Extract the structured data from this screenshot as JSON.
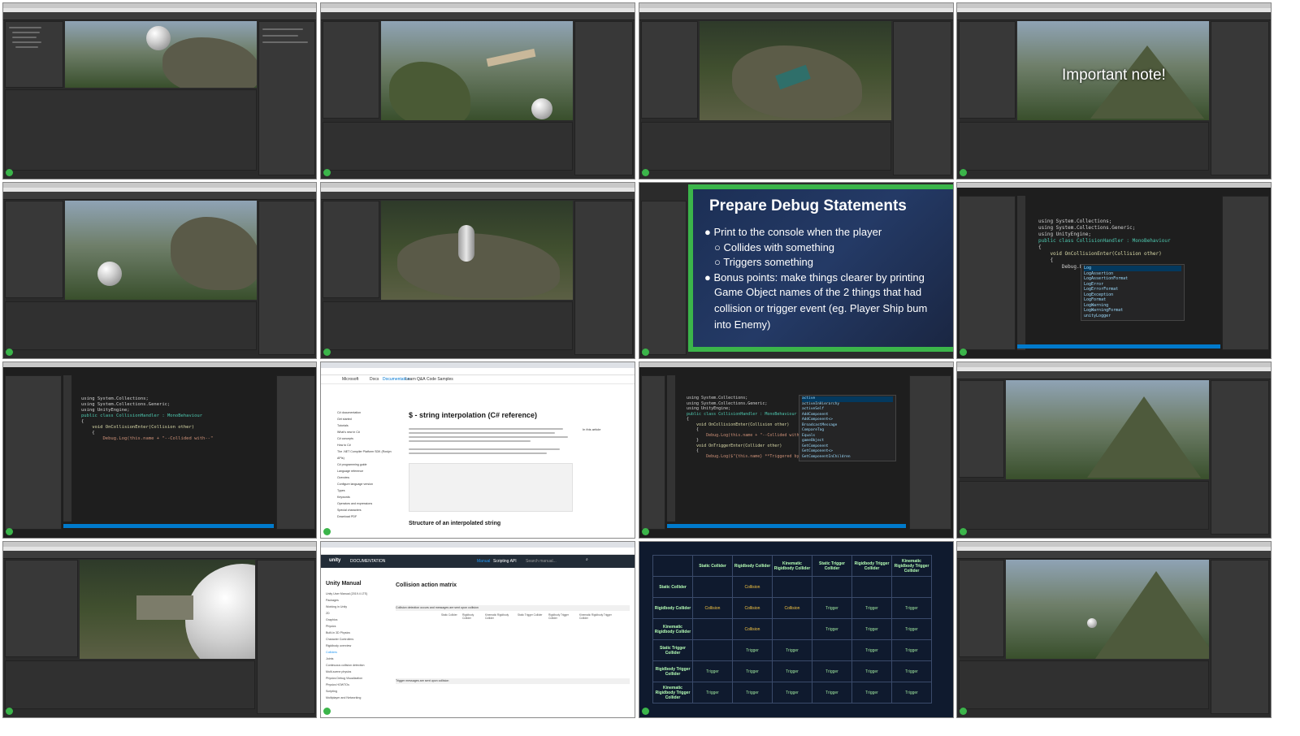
{
  "overlay_note": "Important note!",
  "slide": {
    "title": "Prepare Debug Statements",
    "bullets": [
      "Print to the console when the player",
      "Collides with something",
      "Triggers something",
      "Bonus points: make things clearer by printing",
      "Game Object names of the 2 things that had",
      "collision or trigger event (eg. Player Ship bum",
      "into Enemy)"
    ]
  },
  "code1": {
    "lines": [
      "using System.Collections;",
      "using System.Collections.Generic;",
      "using UnityEngine;",
      "",
      "public class CollisionHandler : MonoBehaviour",
      "{",
      "    void OnCollisionEnter(Collision other)",
      "    {",
      "        Debug.Lo"
    ],
    "suggestions": [
      "Log",
      "LogAssertion",
      "LogAssertionFormat",
      "LogError",
      "LogErrorFormat",
      "LogException",
      "LogFormat",
      "LogWarning",
      "LogWarningFormat",
      "unityLogger"
    ]
  },
  "code2": {
    "lines": [
      "using System.Collections;",
      "using System.Collections.Generic;",
      "using UnityEngine;",
      "",
      "public class CollisionHandler : MonoBehaviour",
      "{",
      "    void OnCollisionEnter(Collision other)",
      "    {",
      "        Debug.Log(this.name + \"--Collided with--\""
    ]
  },
  "code3": {
    "lines": [
      "using System.Collections;",
      "using System.Collections.Generic;",
      "using UnityEngine;",
      "",
      "public class CollisionHandler : MonoBehaviour",
      "{",
      "    void OnCollisionEnter(Collision other)",
      "    {",
      "        Debug.Log(this.name + \"--Collided with--\"",
      "    }",
      "    void OnTriggerEnter(Collider other)",
      "    {",
      "        Debug.Log($\"{this.name} **Triggered by**  {other.gameObject}\""
    ],
    "suggestions": [
      "active",
      "activeInHierarchy",
      "activeSelf",
      "AddComponent",
      "AddComponent<>",
      "BroadcastMessage",
      "CompareTag",
      "Equals",
      "gameObject",
      "GetComponent",
      "GetComponent<>",
      "GetComponentInChildren"
    ]
  },
  "msdoc": {
    "brand": "Microsoft",
    "nav": [
      "Docs",
      "Documentation",
      "Learn",
      "Q&A",
      "Code Samples"
    ],
    "title": "$ - string interpolation (C# reference)",
    "subheading": "Structure of an interpolated string",
    "sidebar": [
      "C# documentation",
      "Get started",
      "Tutorials",
      "What's new in C#",
      "C# concepts",
      "How to C#",
      "The .NET Compiler Platform SDK (Roslyn APIs)",
      "C# programming guide",
      "Language reference",
      "Overview",
      "Configure language version",
      "Types",
      "Keywords",
      "Operators and expressions",
      "Special characters",
      "Download PDF"
    ],
    "onthispage": "In this article"
  },
  "unitydoc": {
    "brand": "unity",
    "section": "DOCUMENTATION",
    "tabs": [
      "Manual",
      "Scripting API"
    ],
    "search_placeholder": "Search manual...",
    "manual_title": "Unity Manual",
    "heading": "Collision action matrix",
    "table1_caption": "Collision detection occurs and messages are sent upon collision",
    "table2_caption": "Trigger messages are sent upon collision",
    "columns": [
      "Static Collider",
      "Rigidbody Collider",
      "Kinematic Rigidbody Collider",
      "Static Trigger Collider",
      "Rigidbody Trigger Collider",
      "Kinematic Rigidbody Trigger Collider"
    ],
    "sidebar": [
      "Unity User Manual (2019.4 LTS)",
      "Packages",
      "Working in Unity",
      "2D",
      "Graphics",
      "Physics",
      "Built-in 3D Physics",
      "Character Controllers",
      "Rigidbody overview",
      "Colliders",
      "Joints",
      "Continuous collision detection",
      "Multi-scene physics",
      "Physics Debug Visualization",
      "Physics HOWTOs",
      "Scripting",
      "Multiplayer and Networking"
    ]
  },
  "matrix": {
    "columns": [
      "Static Collider",
      "Rigidbody Collider",
      "Kinematic Rigidbody Collider",
      "Static Trigger Collider",
      "Rigidbody Trigger Collider",
      "Kinematic Rigidbody Trigger Collider"
    ],
    "rows": [
      {
        "label": "Static Collider",
        "cells": [
          "",
          "Collision",
          "",
          "",
          "",
          ""
        ]
      },
      {
        "label": "Rigidbody Collider",
        "cells": [
          "Collision",
          "Collision",
          "Collision",
          "Trigger",
          "Trigger",
          "Trigger"
        ]
      },
      {
        "label": "Kinematic Rigidbody Collider",
        "cells": [
          "",
          "Collision",
          "",
          "Trigger",
          "Trigger",
          "Trigger"
        ]
      },
      {
        "label": "Static Trigger Collider",
        "cells": [
          "",
          "Trigger",
          "Trigger",
          "",
          "Trigger",
          "Trigger"
        ]
      },
      {
        "label": "Rigidbody Trigger Collider",
        "cells": [
          "Trigger",
          "Trigger",
          "Trigger",
          "Trigger",
          "Trigger",
          "Trigger"
        ]
      },
      {
        "label": "Kinematic Rigidbody Trigger Collider",
        "cells": [
          "Trigger",
          "Trigger",
          "Trigger",
          "Trigger",
          "Trigger",
          "Trigger"
        ]
      }
    ]
  },
  "colors": {
    "unity_dark": "#2b2b2b",
    "slide_green": "#3bb54a",
    "slide_bg": "#1a2a4a",
    "vscode_blue": "#007acc",
    "ms_blue": "#0078d4"
  }
}
